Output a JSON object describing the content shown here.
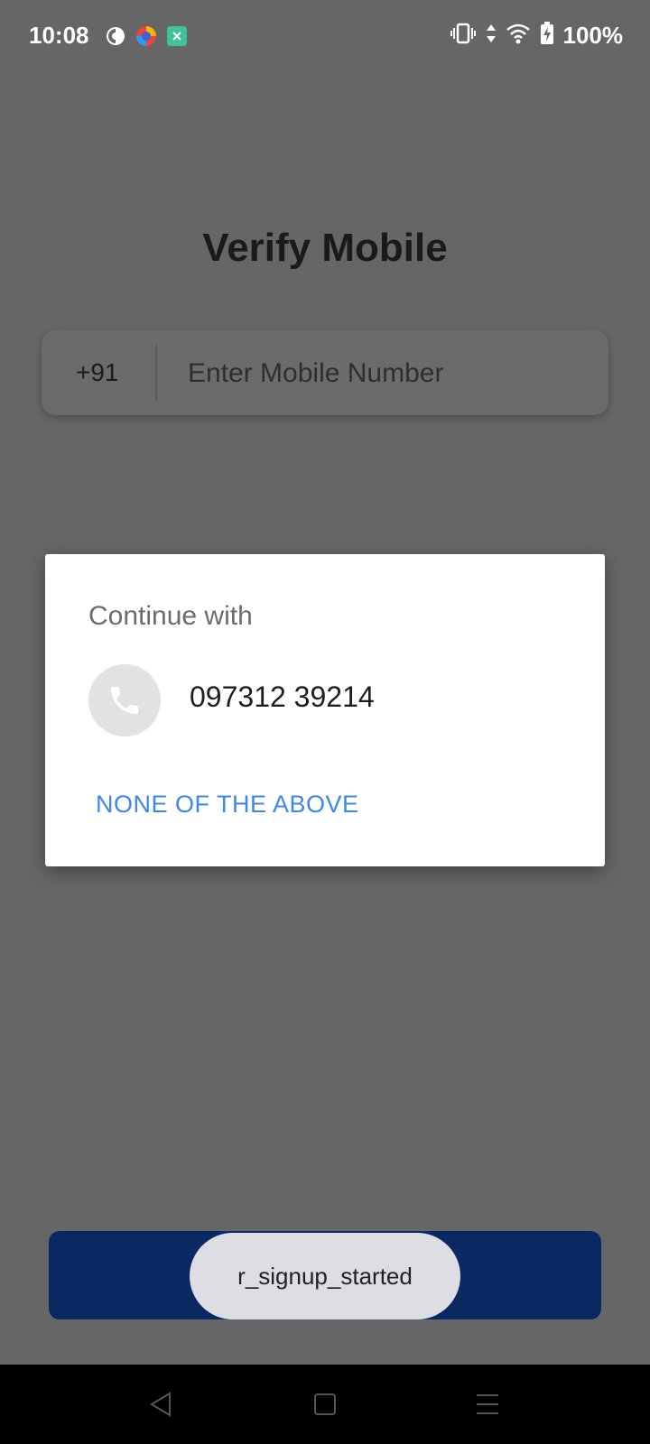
{
  "status_bar": {
    "time": "10:08",
    "battery": "100%",
    "icons": [
      "app-notification-icon",
      "browser-icon",
      "green-app-icon",
      "vibrate-icon",
      "data-arrows-icon",
      "wifi-icon",
      "battery-charging-icon"
    ]
  },
  "screen": {
    "title": "Verify Mobile",
    "country_code": "+91",
    "phone_placeholder": "Enter Mobile Number",
    "phone_value": ""
  },
  "dialog": {
    "title": "Continue with",
    "account_number": "097312 39214",
    "none_label": "NONE OF THE ABOVE"
  },
  "toast": {
    "text": "r_signup_started"
  },
  "colors": {
    "primary_button": "#0a2862",
    "link_blue": "#3f86ea"
  }
}
